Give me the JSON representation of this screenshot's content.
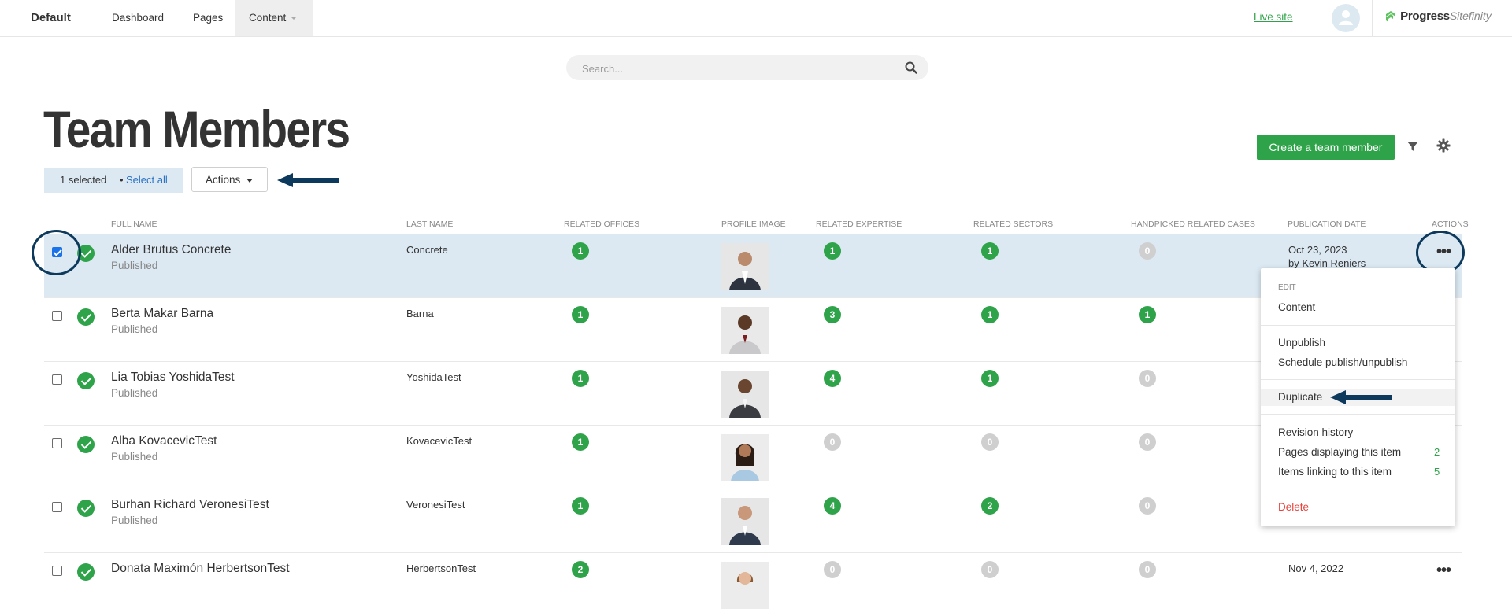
{
  "topbar": {
    "site_name": "Default",
    "nav": [
      "Dashboard",
      "Pages",
      "Content"
    ],
    "live_site": "Live site",
    "logo_text": "Progress",
    "logo_product": "Sitefinity"
  },
  "search": {
    "placeholder": "Search...",
    "value": ""
  },
  "page": {
    "title": "Team Members",
    "selected_count": "1 selected",
    "bullet": "•",
    "select_all": "Select all",
    "actions_label": "Actions",
    "create_button": "Create a team member"
  },
  "table": {
    "headers": [
      "Full name",
      "Last name",
      "Related offices",
      "Profile image",
      "Related expertise",
      "Related sectors",
      "Handpicked related cases",
      "Publication date",
      "Actions"
    ],
    "rows": [
      {
        "full_name": "Alder Brutus Concrete",
        "status": "Published",
        "last_name": "Concrete",
        "offices": "1",
        "expertise": "1",
        "sectors": "1",
        "cases": "0",
        "pub_date": "Oct 23, 2023",
        "pub_by": "by Kevin Reniers",
        "selected": true
      },
      {
        "full_name": "Berta Makar Barna",
        "status": "Published",
        "last_name": "Barna",
        "offices": "1",
        "expertise": "3",
        "sectors": "1",
        "cases": "1",
        "pub_date": "",
        "pub_by": "",
        "selected": false
      },
      {
        "full_name": "Lia Tobias YoshidaTest",
        "status": "Published",
        "last_name": "YoshidaTest",
        "offices": "1",
        "expertise": "4",
        "sectors": "1",
        "cases": "0",
        "pub_date": "",
        "pub_by": "",
        "selected": false
      },
      {
        "full_name": "Alba KovacevicTest",
        "status": "Published",
        "last_name": "KovacevicTest",
        "offices": "1",
        "expertise": "0",
        "sectors": "0",
        "cases": "0",
        "pub_date": "",
        "pub_by": "",
        "selected": false
      },
      {
        "full_name": "Burhan Richard VeronesiTest",
        "status": "Published",
        "last_name": "VeronesiTest",
        "offices": "1",
        "expertise": "4",
        "sectors": "2",
        "cases": "0",
        "pub_date": "",
        "pub_by": "",
        "selected": false
      },
      {
        "full_name": "Donata Maximón HerbertsonTest",
        "status": "",
        "last_name": "HerbertsonTest",
        "offices": "2",
        "expertise": "0",
        "sectors": "0",
        "cases": "0",
        "pub_date": "Nov 4, 2022",
        "pub_by": "",
        "selected": false
      }
    ]
  },
  "menu": {
    "section_edit": "Edit",
    "content": "Content",
    "unpublish": "Unpublish",
    "schedule": "Schedule publish/unpublish",
    "duplicate": "Duplicate",
    "revision_history": "Revision history",
    "pages_displaying": "Pages displaying this item",
    "pages_displaying_count": "2",
    "items_linking": "Items linking to this item",
    "items_linking_count": "5",
    "delete": "Delete"
  },
  "colors": {
    "accent_green": "#2fa34a",
    "selection_blue": "#dce9f3",
    "annotation_navy": "#0d3a5c",
    "delete_red": "#e8423a",
    "link_blue": "#2b73c2"
  },
  "icons": [
    "search-icon",
    "filter-icon",
    "gear-icon",
    "user-avatar-icon",
    "published-check-icon",
    "more-actions-icon",
    "caret-down-icon",
    "annotation-arrow"
  ]
}
